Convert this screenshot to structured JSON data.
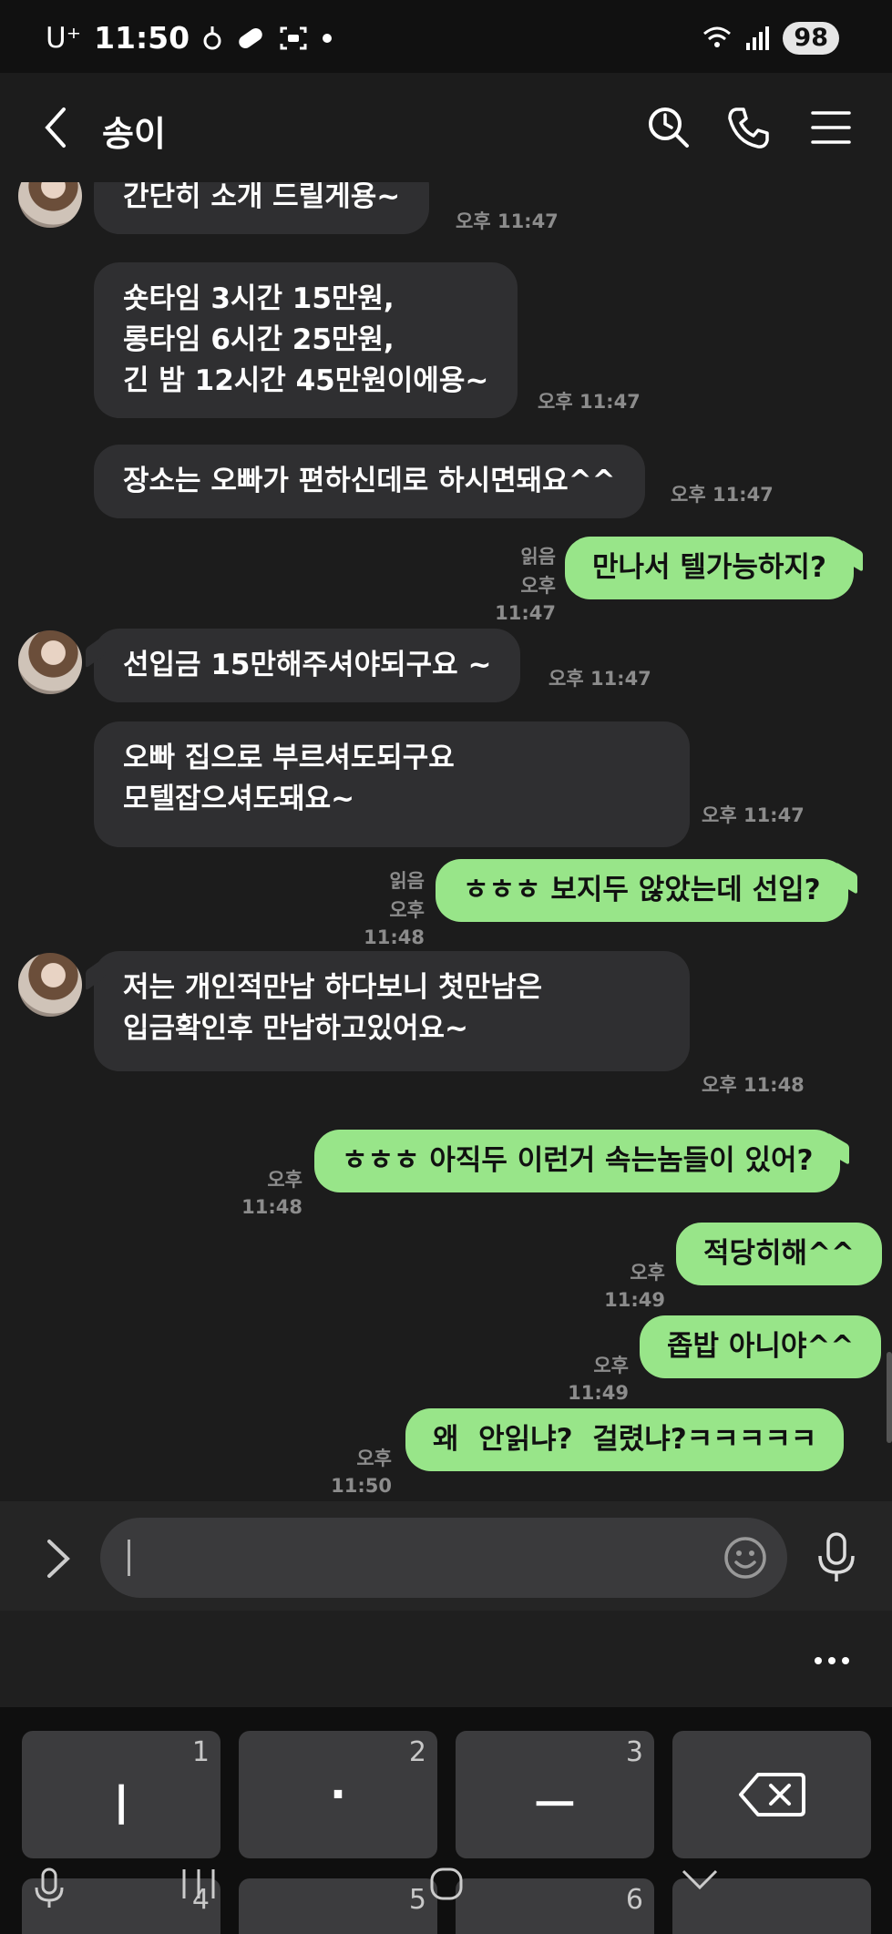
{
  "status_bar": {
    "carrier": "U⁺",
    "time": "11:50",
    "battery": "98",
    "icons": [
      "lightbulb-icon",
      "capsule-icon",
      "screenshot-icon",
      "dot-icon",
      "wifi-icon",
      "signal-icon"
    ]
  },
  "header": {
    "title": "송이",
    "back_icon": "chevron-left-icon",
    "actions": [
      "search-clock-icon",
      "phone-icon",
      "menu-icon"
    ]
  },
  "messages": [
    {
      "dir": "in",
      "text": "간단히 소개 드릴게용~",
      "time": "오후 11:47",
      "avatar": true
    },
    {
      "dir": "in",
      "text": "숏타임 3시간 15만원,\n롱타임 6시간 25만원,\n긴 밤 12시간 45만원이에용~",
      "time": "오후 11:47"
    },
    {
      "dir": "in",
      "text": "장소는 오빠가 편하신데로 하시면돼요^^",
      "time": "오후 11:47"
    },
    {
      "dir": "out",
      "text": "만나서 텔가능하지?",
      "time": "오후 11:47",
      "read": "읽음"
    },
    {
      "dir": "in",
      "text": "선입금 15만해주셔야되구요 ~",
      "time": "오후 11:47",
      "avatar": true
    },
    {
      "dir": "in",
      "text": "오빠 집으로 부르셔도되구요\n모텔잡으셔도돼요~",
      "time": "오후 11:47"
    },
    {
      "dir": "out",
      "text": "ㅎㅎㅎ 보지두 않았는데 선입?",
      "time": "오후 11:48",
      "read": "읽음"
    },
    {
      "dir": "in",
      "text": "저는 개인적만남 하다보니 첫만남은\n입금확인후 만남하고있어요~",
      "time": "오후 11:48",
      "avatar": true
    },
    {
      "dir": "out",
      "text": "ㅎㅎㅎ 아직두 이런거 속는놈들이 있어?",
      "time": "오후 11:48"
    },
    {
      "dir": "out",
      "text": "적당히해^^",
      "time": "오후 11:49"
    },
    {
      "dir": "out",
      "text": "좁밥 아니야^^",
      "time": "오후 11:49"
    },
    {
      "dir": "out",
      "text": "왜  안읽냐?  걸렸냐?ㅋㅋㅋㅋㅋ",
      "time": "오후 11:50"
    }
  ],
  "input": {
    "placeholder": "",
    "value": ""
  },
  "keyboard": {
    "row1": [
      {
        "glyph": "ㅣ",
        "sub": "1"
      },
      {
        "glyph": "·",
        "sub": "2"
      },
      {
        "glyph": "ㅡ",
        "sub": "3"
      },
      {
        "glyph": "",
        "sub": "",
        "icon": "backspace-icon"
      }
    ],
    "row2": [
      {
        "sub": "4"
      },
      {
        "sub": "5"
      },
      {
        "sub": "6"
      }
    ]
  },
  "colors": {
    "outgoing_bubble": "#98e589",
    "incoming_bubble": "#2f2f31",
    "background": "#1c1c1c"
  }
}
